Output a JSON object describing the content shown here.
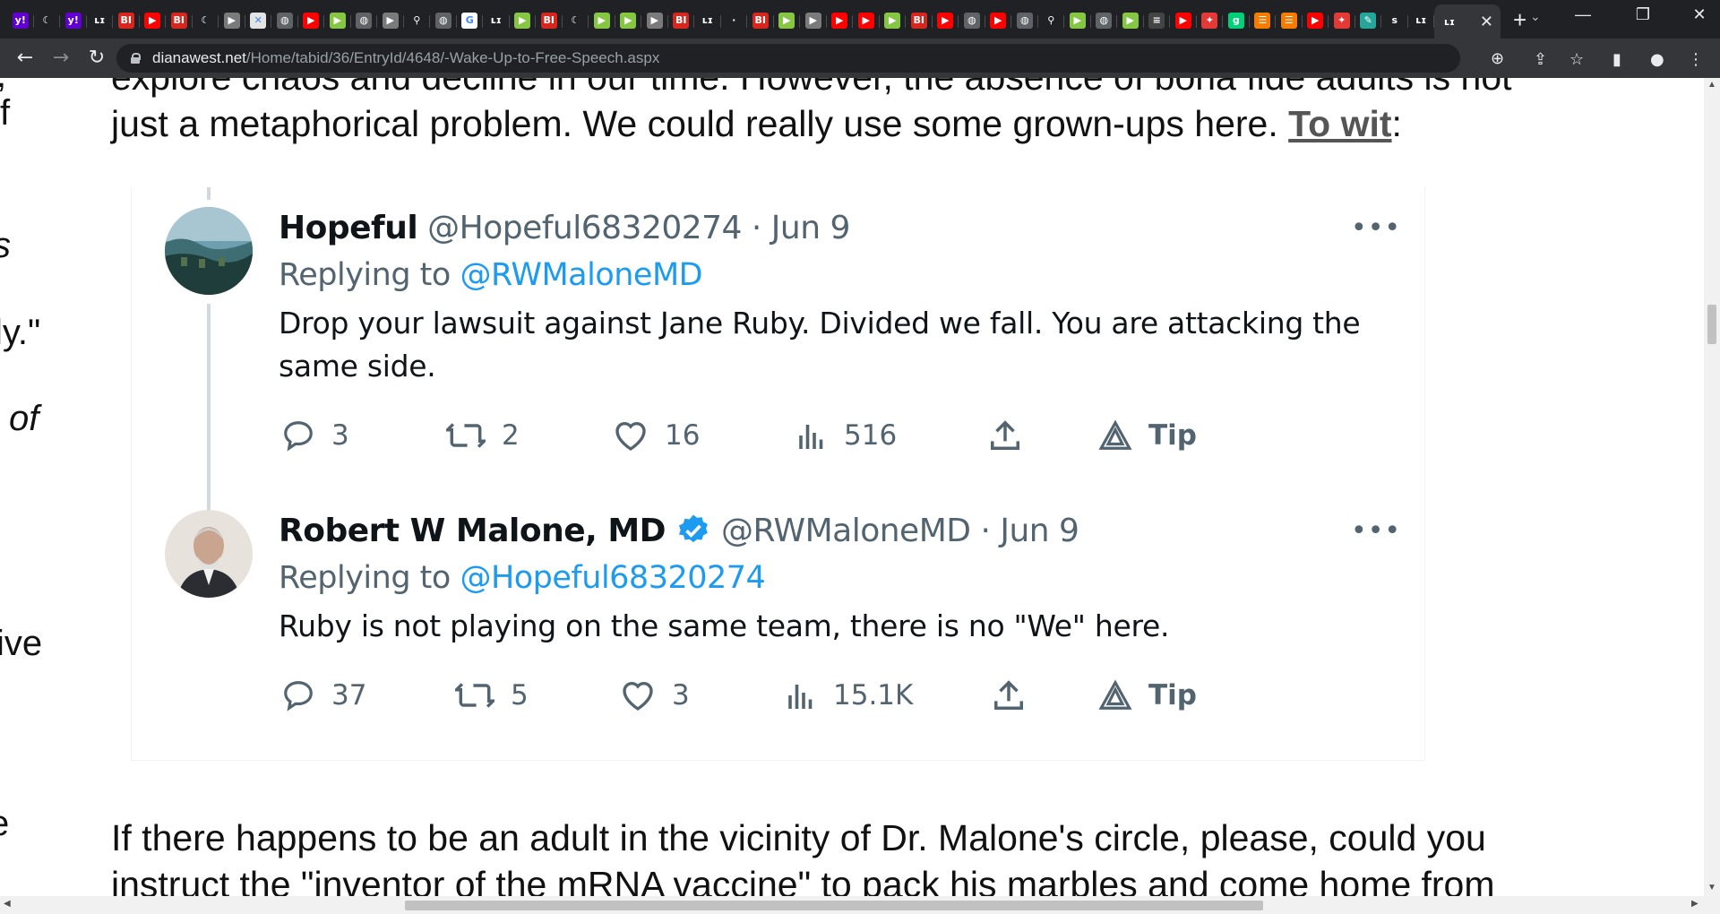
{
  "browser": {
    "tabs": [
      {
        "icon": "yahoo-icon",
        "glyph": "y!",
        "bg": "#6001d2"
      },
      {
        "icon": "shield-icon",
        "glyph": "☾",
        "bg": "#202124"
      },
      {
        "icon": "yahoo-icon",
        "glyph": "y!",
        "bg": "#6001d2"
      },
      {
        "icon": "lik-icon",
        "glyph": "ʟɪ",
        "bg": "#202124"
      },
      {
        "icon": "bi-icon",
        "glyph": "BI",
        "bg": "#d7261e"
      },
      {
        "icon": "youtube-icon",
        "glyph": "▶",
        "bg": "#ff0000"
      },
      {
        "icon": "bi-icon",
        "glyph": "BI",
        "bg": "#d7261e"
      },
      {
        "icon": "shield-icon",
        "glyph": "☾",
        "bg": "#202124"
      },
      {
        "icon": "rumble-icon",
        "glyph": "▶",
        "bg": "#7a7a7a"
      },
      {
        "icon": "maps-icon",
        "glyph": "✕",
        "bg": "#e3e3e3"
      },
      {
        "icon": "globe-icon",
        "glyph": "◍",
        "bg": "#5f6368"
      },
      {
        "icon": "youtube-icon",
        "glyph": "▶",
        "bg": "#ff0000"
      },
      {
        "icon": "rumble-icon",
        "glyph": "▶",
        "bg": "#85c742"
      },
      {
        "icon": "globe-icon",
        "glyph": "◍",
        "bg": "#5f6368"
      },
      {
        "icon": "rumble-icon",
        "glyph": "▶",
        "bg": "#7a7a7a"
      },
      {
        "icon": "search-icon",
        "glyph": "⚲",
        "bg": "#202124"
      },
      {
        "icon": "globe-icon",
        "glyph": "◍",
        "bg": "#5f6368"
      },
      {
        "icon": "google-icon",
        "glyph": "G",
        "bg": "#ffffff"
      },
      {
        "icon": "lik-icon",
        "glyph": "ʟɪ",
        "bg": "#202124"
      },
      {
        "icon": "rumble-icon",
        "glyph": "▶",
        "bg": "#85c742"
      },
      {
        "icon": "bi-icon",
        "glyph": "BI",
        "bg": "#d7261e"
      },
      {
        "icon": "shield-icon",
        "glyph": "☾",
        "bg": "#202124"
      },
      {
        "icon": "rumble-icon",
        "glyph": "▶",
        "bg": "#85c742"
      },
      {
        "icon": "rumble-icon",
        "glyph": "▶",
        "bg": "#85c742"
      },
      {
        "icon": "rumble-icon",
        "glyph": "▶",
        "bg": "#7a7a7a"
      },
      {
        "icon": "bi-icon",
        "glyph": "BI",
        "bg": "#d7261e"
      },
      {
        "icon": "lik-icon",
        "glyph": "ʟɪ",
        "bg": "#202124"
      },
      {
        "icon": "blank-icon",
        "glyph": "·",
        "bg": "#202124"
      },
      {
        "icon": "bi-icon",
        "glyph": "BI",
        "bg": "#d7261e"
      },
      {
        "icon": "rumble-icon",
        "glyph": "▶",
        "bg": "#85c742"
      },
      {
        "icon": "rumble-icon",
        "glyph": "▶",
        "bg": "#7a7a7a"
      },
      {
        "icon": "youtube-icon",
        "glyph": "▶",
        "bg": "#ff0000"
      },
      {
        "icon": "youtube-icon",
        "glyph": "▶",
        "bg": "#ff0000"
      },
      {
        "icon": "rumble-icon",
        "glyph": "▶",
        "bg": "#85c742"
      },
      {
        "icon": "bi-icon",
        "glyph": "BI",
        "bg": "#d7261e"
      },
      {
        "icon": "youtube-icon",
        "glyph": "▶",
        "bg": "#ff0000"
      },
      {
        "icon": "globe-icon",
        "glyph": "◍",
        "bg": "#5f6368"
      },
      {
        "icon": "youtube-icon",
        "glyph": "▶",
        "bg": "#ff0000"
      },
      {
        "icon": "globe-icon",
        "glyph": "◍",
        "bg": "#5f6368"
      },
      {
        "icon": "search-icon",
        "glyph": "⚲",
        "bg": "#202124"
      },
      {
        "icon": "rumble-icon",
        "glyph": "▶",
        "bg": "#85c742"
      },
      {
        "icon": "globe-icon",
        "glyph": "◍",
        "bg": "#5f6368"
      },
      {
        "icon": "rumble-icon",
        "glyph": "▶",
        "bg": "#85c742"
      },
      {
        "icon": "news-icon",
        "glyph": "≡",
        "bg": "#444"
      },
      {
        "icon": "youtube-icon",
        "glyph": "▶",
        "bg": "#ff0000"
      },
      {
        "icon": "podcast-icon",
        "glyph": "✦",
        "bg": "#e53935"
      },
      {
        "icon": "gab-icon",
        "glyph": "g",
        "bg": "#00d178"
      },
      {
        "icon": "bookmark-icon",
        "glyph": "☰",
        "bg": "#f57c00"
      },
      {
        "icon": "bookmark-icon",
        "glyph": "☰",
        "bg": "#f57c00"
      },
      {
        "icon": "youtube-icon",
        "glyph": "▶",
        "bg": "#ff0000"
      },
      {
        "icon": "podcast-icon",
        "glyph": "✦",
        "bg": "#e53935"
      },
      {
        "icon": "tool-icon",
        "glyph": "✎",
        "bg": "#26a69a"
      },
      {
        "icon": "s-icon",
        "glyph": "s",
        "bg": "#202124"
      },
      {
        "icon": "lik-icon",
        "glyph": "ʟɪ",
        "bg": "#202124"
      }
    ],
    "active_tab": {
      "glyph": "ʟɪ",
      "close": "✕"
    },
    "new_tab": "+",
    "tab_search": "⌄",
    "window": {
      "minimize": "—",
      "restore": "❐",
      "close": "✕"
    },
    "nav": {
      "back": "←",
      "forward": "→",
      "reload": "↻"
    },
    "url_host": "dianawest.net",
    "url_path": "/Home/tabid/36/EntryId/4648/-Wake-Up-to-Free-Speech.aspx"
  },
  "article": {
    "top_line1": "explore chaos and decline in our time. However, the absence of bona fide adults is not",
    "top_line2_prefix": "just a metaphorical problem. We could really use some grown-ups here. ",
    "top_link": "To wit",
    "top_line2_suffix": ":",
    "bottom_line1": "If there happens to be an adult in the vicinity of Dr. Malone's circle, please, could you",
    "bottom_line2": "instruct the \"inventor of the mRNA vaccine\" to pack his marbles and come home from",
    "sidebar_fragments": [
      ",",
      "f",
      "s",
      "ly.\"",
      "of",
      "ive",
      "e"
    ]
  },
  "tweets": [
    {
      "name": "Hopeful",
      "handle": "@Hopeful68320274",
      "date": "· Jun 9",
      "replying_label": "Replying to ",
      "replying_to": "@RWMaloneMD",
      "text": "Drop your lawsuit against Jane Ruby. Divided we fall. You are attacking the same side.",
      "replies": "3",
      "retweets": "2",
      "likes": "16",
      "views": "516",
      "tip": "Tip",
      "more": "•••"
    },
    {
      "name": "Robert W Malone, MD",
      "handle": "@RWMaloneMD",
      "date": "· Jun 9",
      "replying_label": "Replying to ",
      "replying_to": "@Hopeful68320274",
      "text": "Ruby is not playing on the same team, there is no \"We\" here.",
      "replies": "37",
      "retweets": "5",
      "likes": "3",
      "views": "15.1K",
      "tip": "Tip",
      "more": "•••"
    }
  ],
  "colors": {
    "link_blue": "#1d9bf0",
    "muted": "#536471",
    "verified": "#1d9bf0"
  }
}
